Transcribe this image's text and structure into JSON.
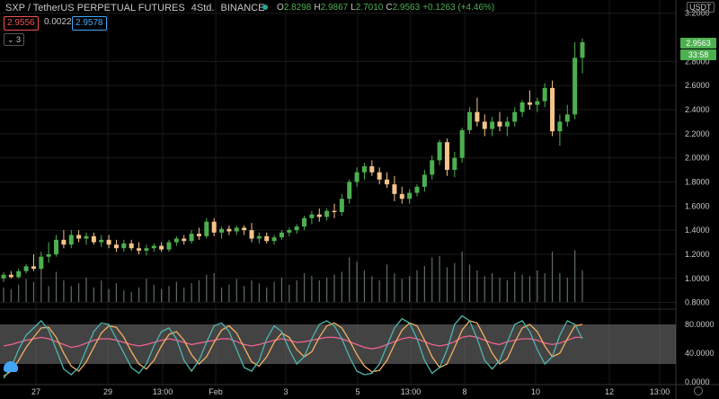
{
  "header": {
    "symbol": "SXP / TetherUS PERPETUAL FUTURES",
    "interval": "4Std.",
    "exchange": "BINANCE",
    "ohlc": {
      "o_label": "O",
      "o": "2.8298",
      "h_label": "H",
      "h": "2.9867",
      "l_label": "L",
      "l": "2.7010",
      "c_label": "C",
      "c": "2.9563",
      "change": "+0.1263 (+4.46%)"
    }
  },
  "trade": {
    "bid": "2.9556",
    "spread": "0.0022",
    "ask": "2.9578"
  },
  "indicator_toggle": "3",
  "axis": {
    "currency": "USDT",
    "price_ticks": [
      "3.2000",
      "2.8000",
      "2.6000",
      "2.4000",
      "2.2000",
      "2.0000",
      "1.8000",
      "1.6000",
      "1.4000",
      "1.2000",
      "1.0000",
      "0.8000"
    ],
    "last_price": "2.9563",
    "countdown": "33:58",
    "osc_ticks": [
      "80.0000",
      "40.0000",
      "0.0000"
    ],
    "time_labels": [
      "27",
      "29",
      "13:00",
      "Feb",
      "3",
      "5",
      "13:00",
      "8",
      "10",
      "12",
      "13:00"
    ]
  },
  "colors": {
    "up": "#4caf50",
    "down": "#f5c48a",
    "volume": "#5f6b6b",
    "stoch_k": "#4db6ac",
    "stoch_d": "#f0b060",
    "rsi": "#f06292",
    "band": "#7a7a7a"
  },
  "chart_data": {
    "type": "candlestick",
    "price_range": [
      0.7,
      3.25
    ],
    "candles": [
      {
        "o": 1.0,
        "h": 1.05,
        "l": 0.97,
        "c": 1.03
      },
      {
        "o": 1.03,
        "h": 1.06,
        "l": 1.0,
        "c": 1.01
      },
      {
        "o": 1.01,
        "h": 1.08,
        "l": 1.0,
        "c": 1.06
      },
      {
        "o": 1.06,
        "h": 1.12,
        "l": 1.04,
        "c": 1.1
      },
      {
        "o": 1.1,
        "h": 1.2,
        "l": 1.06,
        "c": 1.08
      },
      {
        "o": 1.08,
        "h": 1.22,
        "l": 1.07,
        "c": 1.18
      },
      {
        "o": 1.18,
        "h": 1.3,
        "l": 1.13,
        "c": 1.2
      },
      {
        "o": 1.2,
        "h": 1.36,
        "l": 1.18,
        "c": 1.32
      },
      {
        "o": 1.32,
        "h": 1.4,
        "l": 1.25,
        "c": 1.28
      },
      {
        "o": 1.28,
        "h": 1.4,
        "l": 1.25,
        "c": 1.36
      },
      {
        "o": 1.36,
        "h": 1.4,
        "l": 1.3,
        "c": 1.33
      },
      {
        "o": 1.33,
        "h": 1.38,
        "l": 1.28,
        "c": 1.35
      },
      {
        "o": 1.35,
        "h": 1.38,
        "l": 1.28,
        "c": 1.3
      },
      {
        "o": 1.3,
        "h": 1.36,
        "l": 1.26,
        "c": 1.32
      },
      {
        "o": 1.32,
        "h": 1.36,
        "l": 1.25,
        "c": 1.28
      },
      {
        "o": 1.28,
        "h": 1.32,
        "l": 1.22,
        "c": 1.25
      },
      {
        "o": 1.25,
        "h": 1.32,
        "l": 1.22,
        "c": 1.29
      },
      {
        "o": 1.29,
        "h": 1.32,
        "l": 1.23,
        "c": 1.25
      },
      {
        "o": 1.25,
        "h": 1.3,
        "l": 1.2,
        "c": 1.23
      },
      {
        "o": 1.23,
        "h": 1.28,
        "l": 1.19,
        "c": 1.25
      },
      {
        "o": 1.25,
        "h": 1.29,
        "l": 1.22,
        "c": 1.27
      },
      {
        "o": 1.27,
        "h": 1.3,
        "l": 1.22,
        "c": 1.24
      },
      {
        "o": 1.24,
        "h": 1.32,
        "l": 1.22,
        "c": 1.3
      },
      {
        "o": 1.3,
        "h": 1.35,
        "l": 1.27,
        "c": 1.33
      },
      {
        "o": 1.33,
        "h": 1.36,
        "l": 1.28,
        "c": 1.31
      },
      {
        "o": 1.31,
        "h": 1.4,
        "l": 1.29,
        "c": 1.37
      },
      {
        "o": 1.37,
        "h": 1.42,
        "l": 1.32,
        "c": 1.35
      },
      {
        "o": 1.35,
        "h": 1.5,
        "l": 1.33,
        "c": 1.47
      },
      {
        "o": 1.47,
        "h": 1.5,
        "l": 1.35,
        "c": 1.38
      },
      {
        "o": 1.38,
        "h": 1.43,
        "l": 1.33,
        "c": 1.41
      },
      {
        "o": 1.41,
        "h": 1.44,
        "l": 1.36,
        "c": 1.39
      },
      {
        "o": 1.39,
        "h": 1.44,
        "l": 1.36,
        "c": 1.42
      },
      {
        "o": 1.42,
        "h": 1.44,
        "l": 1.36,
        "c": 1.4
      },
      {
        "o": 1.4,
        "h": 1.46,
        "l": 1.3,
        "c": 1.33
      },
      {
        "o": 1.33,
        "h": 1.38,
        "l": 1.29,
        "c": 1.35
      },
      {
        "o": 1.35,
        "h": 1.38,
        "l": 1.29,
        "c": 1.31
      },
      {
        "o": 1.31,
        "h": 1.36,
        "l": 1.28,
        "c": 1.34
      },
      {
        "o": 1.34,
        "h": 1.4,
        "l": 1.32,
        "c": 1.38
      },
      {
        "o": 1.38,
        "h": 1.42,
        "l": 1.35,
        "c": 1.4
      },
      {
        "o": 1.4,
        "h": 1.45,
        "l": 1.37,
        "c": 1.43
      },
      {
        "o": 1.43,
        "h": 1.52,
        "l": 1.4,
        "c": 1.5
      },
      {
        "o": 1.5,
        "h": 1.56,
        "l": 1.45,
        "c": 1.53
      },
      {
        "o": 1.53,
        "h": 1.58,
        "l": 1.47,
        "c": 1.51
      },
      {
        "o": 1.51,
        "h": 1.58,
        "l": 1.48,
        "c": 1.56
      },
      {
        "o": 1.56,
        "h": 1.62,
        "l": 1.5,
        "c": 1.55
      },
      {
        "o": 1.55,
        "h": 1.7,
        "l": 1.52,
        "c": 1.66
      },
      {
        "o": 1.66,
        "h": 1.82,
        "l": 1.62,
        "c": 1.8
      },
      {
        "o": 1.8,
        "h": 1.92,
        "l": 1.76,
        "c": 1.88
      },
      {
        "o": 1.88,
        "h": 1.96,
        "l": 1.82,
        "c": 1.93
      },
      {
        "o": 1.93,
        "h": 1.98,
        "l": 1.85,
        "c": 1.88
      },
      {
        "o": 1.88,
        "h": 1.92,
        "l": 1.78,
        "c": 1.82
      },
      {
        "o": 1.82,
        "h": 1.88,
        "l": 1.75,
        "c": 1.78
      },
      {
        "o": 1.78,
        "h": 1.85,
        "l": 1.64,
        "c": 1.7
      },
      {
        "o": 1.7,
        "h": 1.76,
        "l": 1.62,
        "c": 1.66
      },
      {
        "o": 1.66,
        "h": 1.74,
        "l": 1.62,
        "c": 1.71
      },
      {
        "o": 1.71,
        "h": 1.78,
        "l": 1.68,
        "c": 1.76
      },
      {
        "o": 1.76,
        "h": 1.9,
        "l": 1.72,
        "c": 1.86
      },
      {
        "o": 1.86,
        "h": 2.02,
        "l": 1.82,
        "c": 1.98
      },
      {
        "o": 1.98,
        "h": 2.15,
        "l": 1.94,
        "c": 2.13
      },
      {
        "o": 2.13,
        "h": 2.16,
        "l": 1.85,
        "c": 1.9
      },
      {
        "o": 1.9,
        "h": 2.05,
        "l": 1.84,
        "c": 2.0
      },
      {
        "o": 2.0,
        "h": 2.25,
        "l": 1.96,
        "c": 2.23
      },
      {
        "o": 2.23,
        "h": 2.42,
        "l": 2.2,
        "c": 2.38
      },
      {
        "o": 2.38,
        "h": 2.5,
        "l": 2.26,
        "c": 2.3
      },
      {
        "o": 2.3,
        "h": 2.36,
        "l": 2.18,
        "c": 2.24
      },
      {
        "o": 2.24,
        "h": 2.34,
        "l": 2.18,
        "c": 2.3
      },
      {
        "o": 2.3,
        "h": 2.38,
        "l": 2.22,
        "c": 2.26
      },
      {
        "o": 2.26,
        "h": 2.34,
        "l": 2.18,
        "c": 2.3
      },
      {
        "o": 2.3,
        "h": 2.42,
        "l": 2.26,
        "c": 2.38
      },
      {
        "o": 2.38,
        "h": 2.48,
        "l": 2.34,
        "c": 2.46
      },
      {
        "o": 2.46,
        "h": 2.56,
        "l": 2.4,
        "c": 2.44
      },
      {
        "o": 2.44,
        "h": 2.5,
        "l": 2.38,
        "c": 2.47
      },
      {
        "o": 2.47,
        "h": 2.62,
        "l": 2.42,
        "c": 2.58
      },
      {
        "o": 2.58,
        "h": 2.64,
        "l": 2.18,
        "c": 2.22
      },
      {
        "o": 2.22,
        "h": 2.36,
        "l": 2.1,
        "c": 2.3
      },
      {
        "o": 2.3,
        "h": 2.44,
        "l": 2.26,
        "c": 2.36
      },
      {
        "o": 2.36,
        "h": 2.96,
        "l": 2.32,
        "c": 2.83
      },
      {
        "o": 2.83,
        "h": 2.99,
        "l": 2.7,
        "c": 2.96
      }
    ],
    "volume_range": [
      0,
      1
    ],
    "volumes": [
      0.2,
      0.18,
      0.24,
      0.32,
      0.28,
      0.6,
      0.22,
      0.42,
      0.3,
      0.22,
      0.26,
      0.34,
      0.2,
      0.3,
      0.18,
      0.26,
      0.16,
      0.14,
      0.2,
      0.32,
      0.24,
      0.18,
      0.22,
      0.28,
      0.2,
      0.26,
      0.3,
      0.38,
      0.4,
      0.2,
      0.24,
      0.32,
      0.22,
      0.3,
      0.26,
      0.2,
      0.28,
      0.34,
      0.24,
      0.3,
      0.4,
      0.36,
      0.3,
      0.34,
      0.38,
      0.42,
      0.62,
      0.56,
      0.44,
      0.36,
      0.3,
      0.52,
      0.4,
      0.32,
      0.36,
      0.44,
      0.5,
      0.62,
      0.64,
      0.48,
      0.54,
      0.7,
      0.52,
      0.44,
      0.36,
      0.4,
      0.34,
      0.3,
      0.42,
      0.38,
      0.36,
      0.44,
      0.4,
      0.7,
      0.4,
      0.34,
      0.72,
      0.44
    ],
    "oscillator": {
      "ylim": [
        0,
        100
      ],
      "band": [
        25,
        80
      ],
      "k": [
        5,
        20,
        45,
        65,
        75,
        85,
        72,
        45,
        18,
        10,
        20,
        45,
        70,
        82,
        80,
        60,
        40,
        20,
        12,
        25,
        50,
        70,
        75,
        60,
        30,
        15,
        30,
        55,
        78,
        82,
        70,
        45,
        20,
        15,
        30,
        60,
        78,
        70,
        45,
        25,
        35,
        60,
        80,
        85,
        78,
        60,
        35,
        15,
        10,
        12,
        25,
        50,
        75,
        88,
        82,
        60,
        30,
        12,
        20,
        45,
        80,
        92,
        85,
        60,
        30,
        18,
        30,
        55,
        80,
        85,
        70,
        45,
        25,
        35,
        65,
        85,
        80,
        60
      ],
      "d": [
        8,
        15,
        30,
        48,
        62,
        75,
        76,
        62,
        40,
        22,
        15,
        28,
        48,
        68,
        78,
        76,
        62,
        42,
        25,
        18,
        30,
        50,
        66,
        70,
        58,
        38,
        25,
        35,
        55,
        72,
        78,
        68,
        48,
        28,
        22,
        35,
        55,
        68,
        62,
        45,
        35,
        42,
        62,
        78,
        82,
        75,
        58,
        38,
        22,
        14,
        16,
        30,
        52,
        72,
        82,
        78,
        58,
        35,
        20,
        25,
        48,
        72,
        85,
        82,
        62,
        40,
        25,
        32,
        55,
        75,
        80,
        70,
        50,
        35,
        40,
        60,
        78,
        80
      ],
      "rsi": [
        50,
        52,
        55,
        58,
        60,
        62,
        60,
        56,
        52,
        48,
        50,
        54,
        58,
        60,
        60,
        58,
        55,
        52,
        50,
        52,
        55,
        58,
        60,
        58,
        55,
        52,
        54,
        56,
        58,
        60,
        60,
        56,
        52,
        50,
        52,
        55,
        58,
        60,
        58,
        55,
        56,
        58,
        60,
        62,
        62,
        60,
        56,
        52,
        48,
        46,
        48,
        52,
        56,
        60,
        62,
        60,
        56,
        52,
        50,
        52,
        56,
        62,
        64,
        62,
        58,
        54,
        52,
        56,
        58,
        60,
        60,
        58,
        54,
        52,
        54,
        58,
        62,
        62
      ]
    }
  }
}
